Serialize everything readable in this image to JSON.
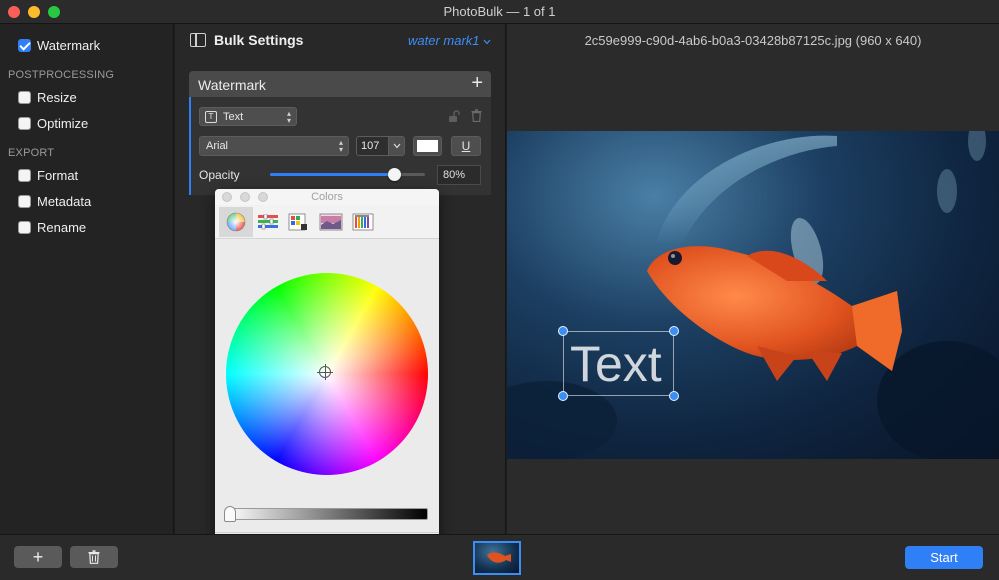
{
  "window": {
    "title": "PhotoBulk — 1 of 1"
  },
  "sidebar": {
    "watermark": {
      "label": "Watermark",
      "checked": true
    },
    "postprocessing_header": "POSTPROCESSING",
    "resize": {
      "label": "Resize",
      "checked": false
    },
    "optimize": {
      "label": "Optimize",
      "checked": false
    },
    "export_header": "EXPORT",
    "format": {
      "label": "Format",
      "checked": false
    },
    "metadata": {
      "label": "Metadata",
      "checked": false
    },
    "rename": {
      "label": "Rename",
      "checked": false
    }
  },
  "settings": {
    "title": "Bulk Settings",
    "preset": "water mark1",
    "card_title": "Watermark",
    "type_value": "Text",
    "font_value": "Arial",
    "size_value": "107",
    "underline_label": "U",
    "opacity_label": "Opacity",
    "opacity_value": "80%",
    "opacity_fraction": 0.8,
    "color": "#ffffff"
  },
  "colors_panel": {
    "title": "Colors",
    "tabs": [
      "color-wheel-icon",
      "sliders-icon",
      "palettes-icon",
      "image-palettes-icon",
      "pencils-icon"
    ],
    "selected_tab": "color-wheel-icon",
    "brightness_fraction": 0.0,
    "current_color": "#ffffff"
  },
  "preview": {
    "filename": "2c59e999-c90d-4ab6-b0a3-03428b87125c.jpg (960 x 640)",
    "watermark_text": "Text"
  },
  "bottombar": {
    "add_label": "+",
    "start_label": "Start"
  },
  "colors": {
    "accent": "#2f7ff7",
    "fish": "#e0521f"
  }
}
